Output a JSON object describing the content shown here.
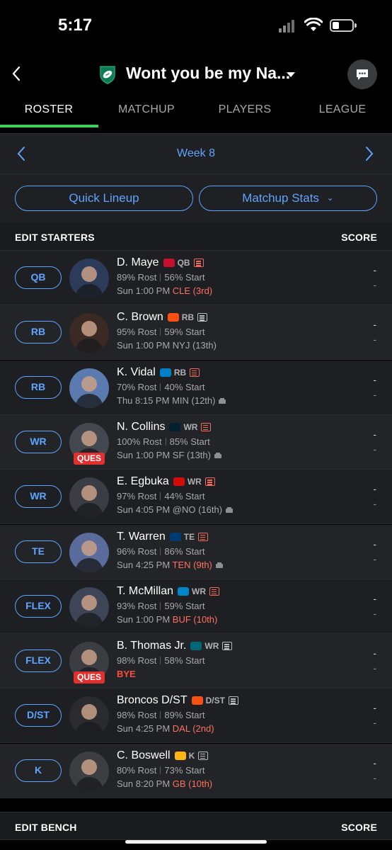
{
  "status": {
    "time": "5:17"
  },
  "header": {
    "league_name": "Wont you be my Na...",
    "back_icon": "chevron-left-icon",
    "chat_icon": "chat-bubble-icon"
  },
  "tabs": [
    {
      "label": "ROSTER",
      "active": true
    },
    {
      "label": "MATCHUP",
      "active": false
    },
    {
      "label": "PLAYERS",
      "active": false
    },
    {
      "label": "LEAGUE",
      "active": false
    }
  ],
  "week": {
    "label": "Week 8"
  },
  "actions": {
    "quick_lineup": "Quick Lineup",
    "matchup_stats": "Matchup Stats"
  },
  "starters_header": {
    "left": "EDIT STARTERS",
    "right": "SCORE"
  },
  "bench_header": {
    "left": "EDIT BENCH",
    "right": "SCORE"
  },
  "players": [
    {
      "slot": "QB",
      "name": "D. Maye",
      "pos": "QB",
      "news_alert": true,
      "rost": "89% Rost",
      "start": "56% Start",
      "time": "Sun 1:00 PM",
      "opp": "CLE (3rd)",
      "opp_color": "red",
      "weather": false,
      "injury": "",
      "score1": "-",
      "score2": "-"
    },
    {
      "slot": "RB",
      "name": "C. Brown",
      "pos": "RB",
      "news_alert": false,
      "rost": "95% Rost",
      "start": "59% Start",
      "time": "Sun 1:00 PM",
      "opp": "NYJ (13th)",
      "opp_color": "neutral",
      "weather": false,
      "injury": "",
      "score1": "-",
      "score2": "-"
    },
    {
      "slot": "RB",
      "name": "K. Vidal",
      "pos": "RB",
      "news_alert": true,
      "rost": "70% Rost",
      "start": "40% Start",
      "time": "Thu 8:15 PM",
      "opp": "MIN (12th)",
      "opp_color": "neutral",
      "weather": true,
      "injury": "",
      "score1": "-",
      "score2": "-"
    },
    {
      "slot": "WR",
      "name": "N. Collins",
      "pos": "WR",
      "news_alert": true,
      "rost": "100% Rost",
      "start": "85% Start",
      "time": "Sun 1:00 PM",
      "opp": "SF (13th)",
      "opp_color": "neutral",
      "weather": true,
      "injury": "QUES",
      "score1": "-",
      "score2": "-"
    },
    {
      "slot": "WR",
      "name": "E. Egbuka",
      "pos": "WR",
      "news_alert": true,
      "rost": "97% Rost",
      "start": "44% Start",
      "time": "Sun 4:05 PM",
      "opp": "@NO (16th)",
      "opp_color": "neutral",
      "weather": true,
      "injury": "",
      "score1": "-",
      "score2": "-"
    },
    {
      "slot": "TE",
      "name": "T. Warren",
      "pos": "TE",
      "news_alert": true,
      "rost": "96% Rost",
      "start": "86% Start",
      "time": "Sun 4:25 PM",
      "opp": "TEN (9th)",
      "opp_color": "red",
      "weather": true,
      "injury": "",
      "score1": "-",
      "score2": "-"
    },
    {
      "slot": "FLEX",
      "name": "T. McMillan",
      "pos": "WR",
      "news_alert": true,
      "rost": "93% Rost",
      "start": "59% Start",
      "time": "Sun 1:00 PM",
      "opp": "BUF (10th)",
      "opp_color": "red",
      "weather": false,
      "injury": "",
      "score1": "-",
      "score2": "-"
    },
    {
      "slot": "FLEX",
      "name": "B. Thomas Jr.",
      "pos": "WR",
      "news_alert": false,
      "rost": "98% Rost",
      "start": "58% Start",
      "time": "",
      "opp": "BYE",
      "opp_color": "bye",
      "weather": false,
      "injury": "QUES",
      "score1": "-",
      "score2": "-"
    },
    {
      "slot": "D/ST",
      "name": "Broncos D/ST",
      "pos": "D/ST",
      "news_alert": false,
      "rost": "98% Rost",
      "start": "89% Start",
      "time": "Sun 4:25 PM",
      "opp": "DAL (2nd)",
      "opp_color": "red",
      "weather": false,
      "injury": "",
      "score1": "-",
      "score2": "-"
    },
    {
      "slot": "K",
      "name": "C. Boswell",
      "pos": "K",
      "news_alert": false,
      "rost": "80% Rost",
      "start": "73% Start",
      "time": "Sun 8:20 PM",
      "opp": "GB (10th)",
      "opp_color": "red",
      "weather": false,
      "injury": "",
      "score1": "-",
      "score2": "-"
    }
  ],
  "colors": {
    "accent": "#5fa4ff",
    "tab_underline": "#3dd15c",
    "injury": "#e2302f",
    "tough_matchup": "#ff7060"
  }
}
